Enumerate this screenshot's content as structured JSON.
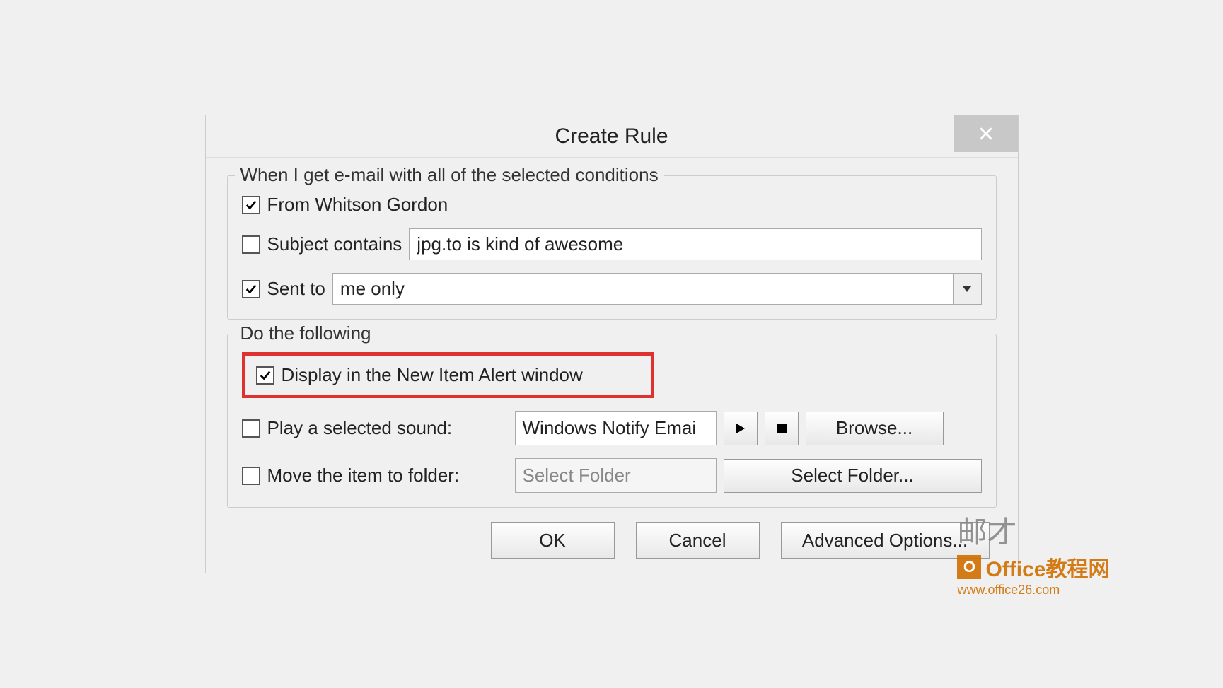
{
  "dialog": {
    "title": "Create Rule"
  },
  "conditions": {
    "legend": "When I get e-mail with all of the selected conditions",
    "from_label": "From Whitson Gordon",
    "subject_label": "Subject contains",
    "subject_value": "jpg.to is kind of awesome",
    "sent_to_label": "Sent to",
    "sent_to_value": "me only"
  },
  "actions": {
    "legend": "Do the following",
    "display_alert_label": "Display in the New Item Alert window",
    "play_sound_label": "Play a selected sound:",
    "sound_name": "Windows Notify Emai",
    "browse_label": "Browse...",
    "move_label": "Move the item to folder:",
    "folder_placeholder": "Select Folder",
    "select_folder_label": "Select Folder..."
  },
  "buttons": {
    "ok": "OK",
    "cancel": "Cancel",
    "advanced": "Advanced Options..."
  },
  "watermark": {
    "top": "邮才",
    "mid": "Office教程网",
    "bot": "www.office26.com",
    "badge": "O"
  }
}
